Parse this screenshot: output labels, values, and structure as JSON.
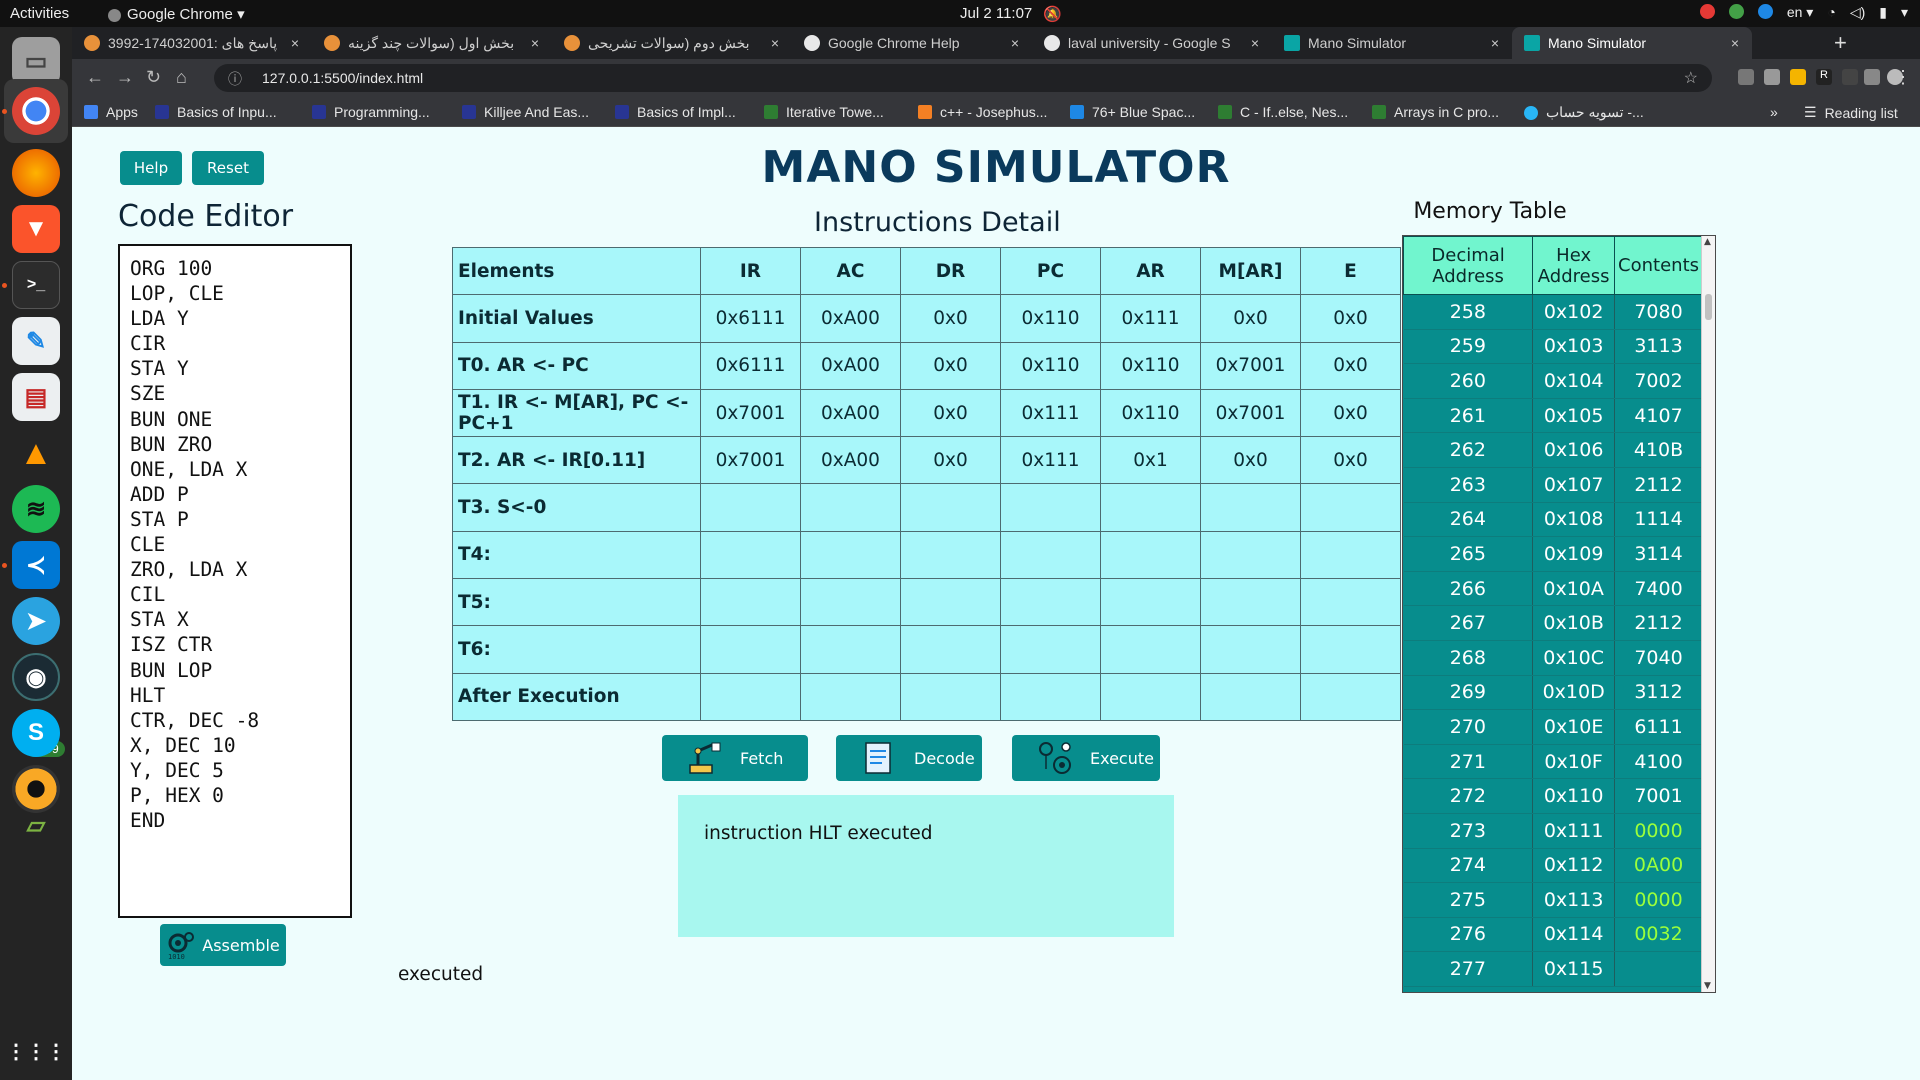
{
  "system": {
    "activities": "Activities",
    "app_name": "Google Chrome",
    "clock": "Jul 2  11:07",
    "lang": "en"
  },
  "dock": {
    "badge": "9999"
  },
  "tabs": [
    {
      "title": "پاسخ های :174032001-3992",
      "fav_color": "#e8913a"
    },
    {
      "title": "بخش اول (سوالات چند گزینه",
      "fav_color": "#e8913a"
    },
    {
      "title": "بخش دوم (سوالات تشریحی",
      "fav_color": "#e8913a"
    },
    {
      "title": "Google Chrome Help",
      "fav_color": "#e8e8e8"
    },
    {
      "title": "laval university - Google S",
      "fav_color": "#e8e8e8"
    },
    {
      "title": "Mano Simulator",
      "fav_color": "#0aa5a5"
    },
    {
      "title": "Mano Simulator",
      "fav_color": "#0aa5a5"
    }
  ],
  "address": {
    "url": "127.0.0.1:5500/index.html"
  },
  "bookmarks": [
    {
      "label": "Apps",
      "color": "#4285f4"
    },
    {
      "label": "Basics of Inpu...",
      "color": "#283593"
    },
    {
      "label": "Programming...",
      "color": "#283593"
    },
    {
      "label": "Killjee And Eas...",
      "color": "#283593"
    },
    {
      "label": "Basics of Impl...",
      "color": "#283593"
    },
    {
      "label": "Iterative Towe...",
      "color": "#2e7d32"
    },
    {
      "label": "c++ - Josephus...",
      "color": "#f48024"
    },
    {
      "label": "76+ Blue Spac...",
      "color": "#1e88e5"
    },
    {
      "label": "C - If..else, Nes...",
      "color": "#2e7d32"
    },
    {
      "label": "Arrays in C pro...",
      "color": "#2e7d32"
    },
    {
      "label": "تسویه حساب -...",
      "color": "#29b6f6"
    }
  ],
  "bookmarks_more": "»",
  "reading_list": "Reading list",
  "page": {
    "title": "MANO SIMULATOR",
    "help_label": "Help",
    "reset_label": "Reset",
    "code_editor_title": "Code Editor",
    "code_lines": [
      "ORG 100",
      "LOP, CLE",
      "LDA Y",
      "CIR",
      "STA Y",
      "SZE",
      "BUN ONE",
      "BUN ZRO",
      "ONE, LDA X",
      "ADD P",
      "STA P",
      "CLE",
      "ZRO, LDA X",
      "CIL",
      "STA X",
      "ISZ CTR",
      "BUN LOP",
      "HLT",
      "CTR, DEC -8",
      "X, DEC 10",
      "Y, DEC 5",
      "P, HEX 0",
      "END"
    ],
    "assemble_label": "Assemble",
    "instructions_title": "Instructions Detail",
    "instr_headers": [
      "Elements",
      "IR",
      "AC",
      "DR",
      "PC",
      "AR",
      "M[AR]",
      "E"
    ],
    "instr_rows": [
      [
        "Initial Values",
        "0x6111",
        "0xA00",
        "0x0",
        "0x110",
        "0x111",
        "0x0",
        "0x0"
      ],
      [
        "T0. AR <- PC",
        "0x6111",
        "0xA00",
        "0x0",
        "0x110",
        "0x110",
        "0x7001",
        "0x0"
      ],
      [
        "T1. IR <- M[AR], PC <-PC+1",
        "0x7001",
        "0xA00",
        "0x0",
        "0x111",
        "0x110",
        "0x7001",
        "0x0"
      ],
      [
        "T2. AR <- IR[0.11]",
        "0x7001",
        "0xA00",
        "0x0",
        "0x111",
        "0x1",
        "0x0",
        "0x0"
      ],
      [
        "T3. S<-0",
        "",
        "",
        "",
        "",
        "",
        "",
        ""
      ],
      [
        "T4:",
        "",
        "",
        "",
        "",
        "",
        "",
        ""
      ],
      [
        "T5:",
        "",
        "",
        "",
        "",
        "",
        "",
        ""
      ],
      [
        "T6:",
        "",
        "",
        "",
        "",
        "",
        "",
        ""
      ],
      [
        "After Execution",
        "",
        "",
        "",
        "",
        "",
        "",
        ""
      ]
    ],
    "fetch_label": "Fetch",
    "decode_label": "Decode",
    "execute_label": "Execute",
    "message": "instruction HLT executed",
    "status": "executed",
    "memory_title": "Memory Table",
    "memory_headers": [
      "Decimal Address",
      "Hex Address",
      "Contents"
    ],
    "memory_rows": [
      [
        "258",
        "0x102",
        "7080"
      ],
      [
        "259",
        "0x103",
        "3113"
      ],
      [
        "260",
        "0x104",
        "7002"
      ],
      [
        "261",
        "0x105",
        "4107"
      ],
      [
        "262",
        "0x106",
        "410B"
      ],
      [
        "263",
        "0x107",
        "2112"
      ],
      [
        "264",
        "0x108",
        "1114"
      ],
      [
        "265",
        "0x109",
        "3114"
      ],
      [
        "266",
        "0x10A",
        "7400"
      ],
      [
        "267",
        "0x10B",
        "2112"
      ],
      [
        "268",
        "0x10C",
        "7040"
      ],
      [
        "269",
        "0x10D",
        "3112"
      ],
      [
        "270",
        "0x10E",
        "6111"
      ],
      [
        "271",
        "0x10F",
        "4100"
      ],
      [
        "272",
        "0x110",
        "7001"
      ],
      [
        "273",
        "0x111",
        "0000"
      ],
      [
        "274",
        "0x112",
        "0A00"
      ],
      [
        "275",
        "0x113",
        "0000"
      ],
      [
        "276",
        "0x114",
        "0032"
      ],
      [
        "277",
        "0x115",
        ""
      ]
    ],
    "memory_highlight_color": "#9bff3b"
  }
}
